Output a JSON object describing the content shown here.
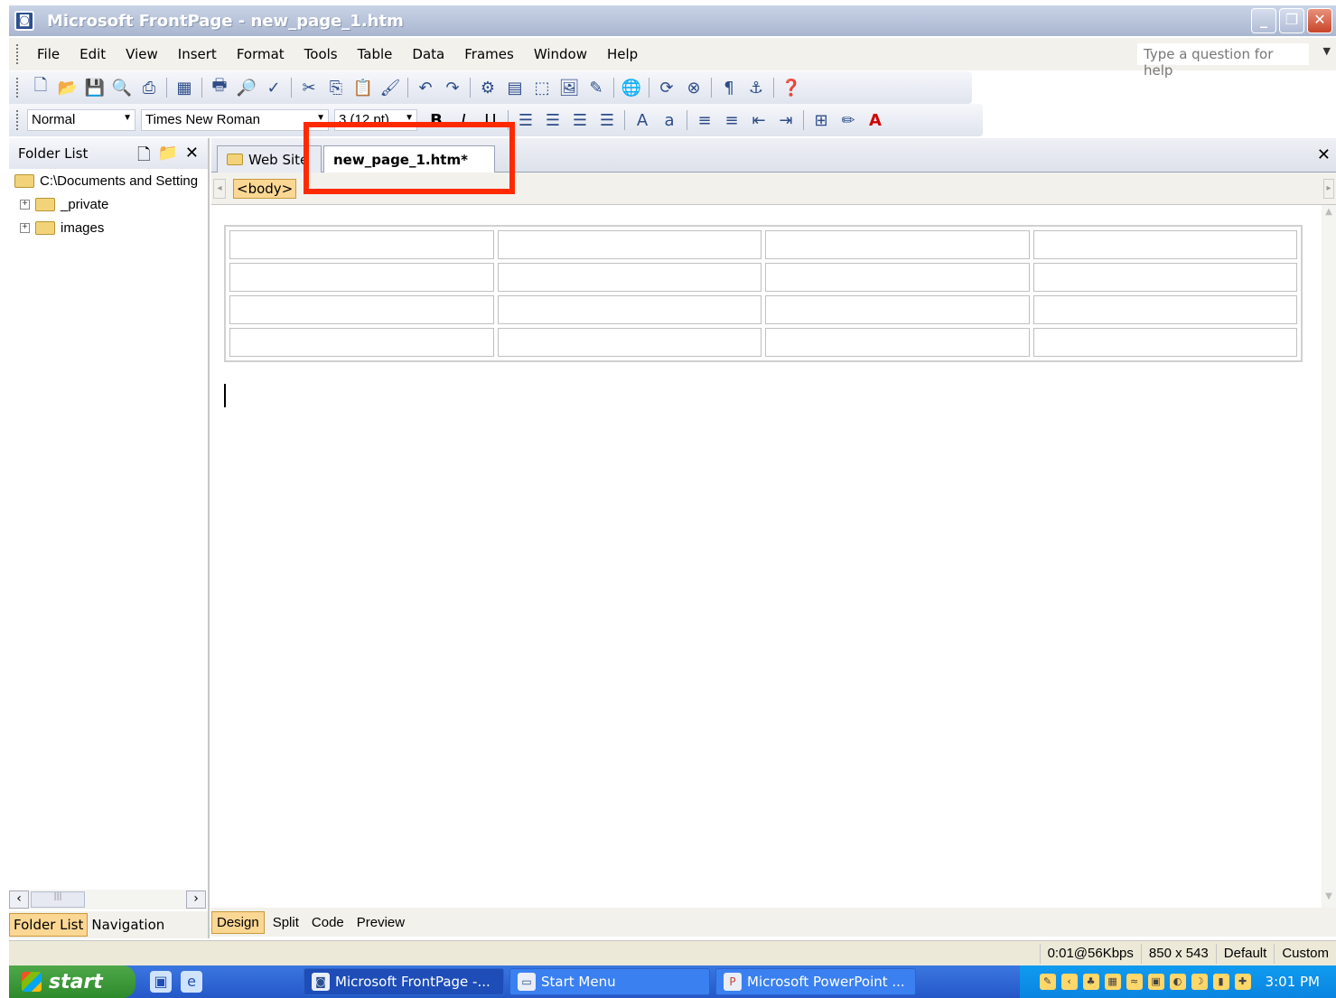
{
  "window": {
    "title": "Microsoft FrontPage - new_page_1.htm",
    "controls": {
      "minimize": "_",
      "restore": "❐",
      "close": "✕"
    }
  },
  "menu": {
    "items": [
      "File",
      "Edit",
      "View",
      "Insert",
      "Format",
      "Tools",
      "Table",
      "Data",
      "Frames",
      "Window",
      "Help"
    ],
    "help_placeholder": "Type a question for help"
  },
  "formatting": {
    "style": "Normal",
    "font": "Times New Roman",
    "size": "3 (12 pt)",
    "bold": "B",
    "italic": "I",
    "underline": "U"
  },
  "folder_list": {
    "title": "Folder List",
    "root": "C:\\Documents and Setting",
    "folders": [
      "_private",
      "images"
    ]
  },
  "left_tabs": {
    "folder_list": "Folder List",
    "navigation": "Navigation"
  },
  "doc_tabs": {
    "web_site": "Web Site",
    "current": "new_page_1.htm*"
  },
  "tag_selector": "<body>",
  "table": {
    "rows": 4,
    "cols": 4
  },
  "view_tabs": [
    "Design",
    "Split",
    "Code",
    "Preview"
  ],
  "status": {
    "speed": "0:01@56Kbps",
    "dimensions": "850 x 543",
    "style": "Default",
    "custom": "Custom"
  },
  "taskbar": {
    "start": "start",
    "tasks": [
      "Microsoft FrontPage -...",
      "Start Menu",
      "Microsoft PowerPoint ..."
    ],
    "time": "3:01 PM"
  },
  "colors": {
    "highlight": "#ff2a00",
    "active_tab": "#fbd794"
  }
}
